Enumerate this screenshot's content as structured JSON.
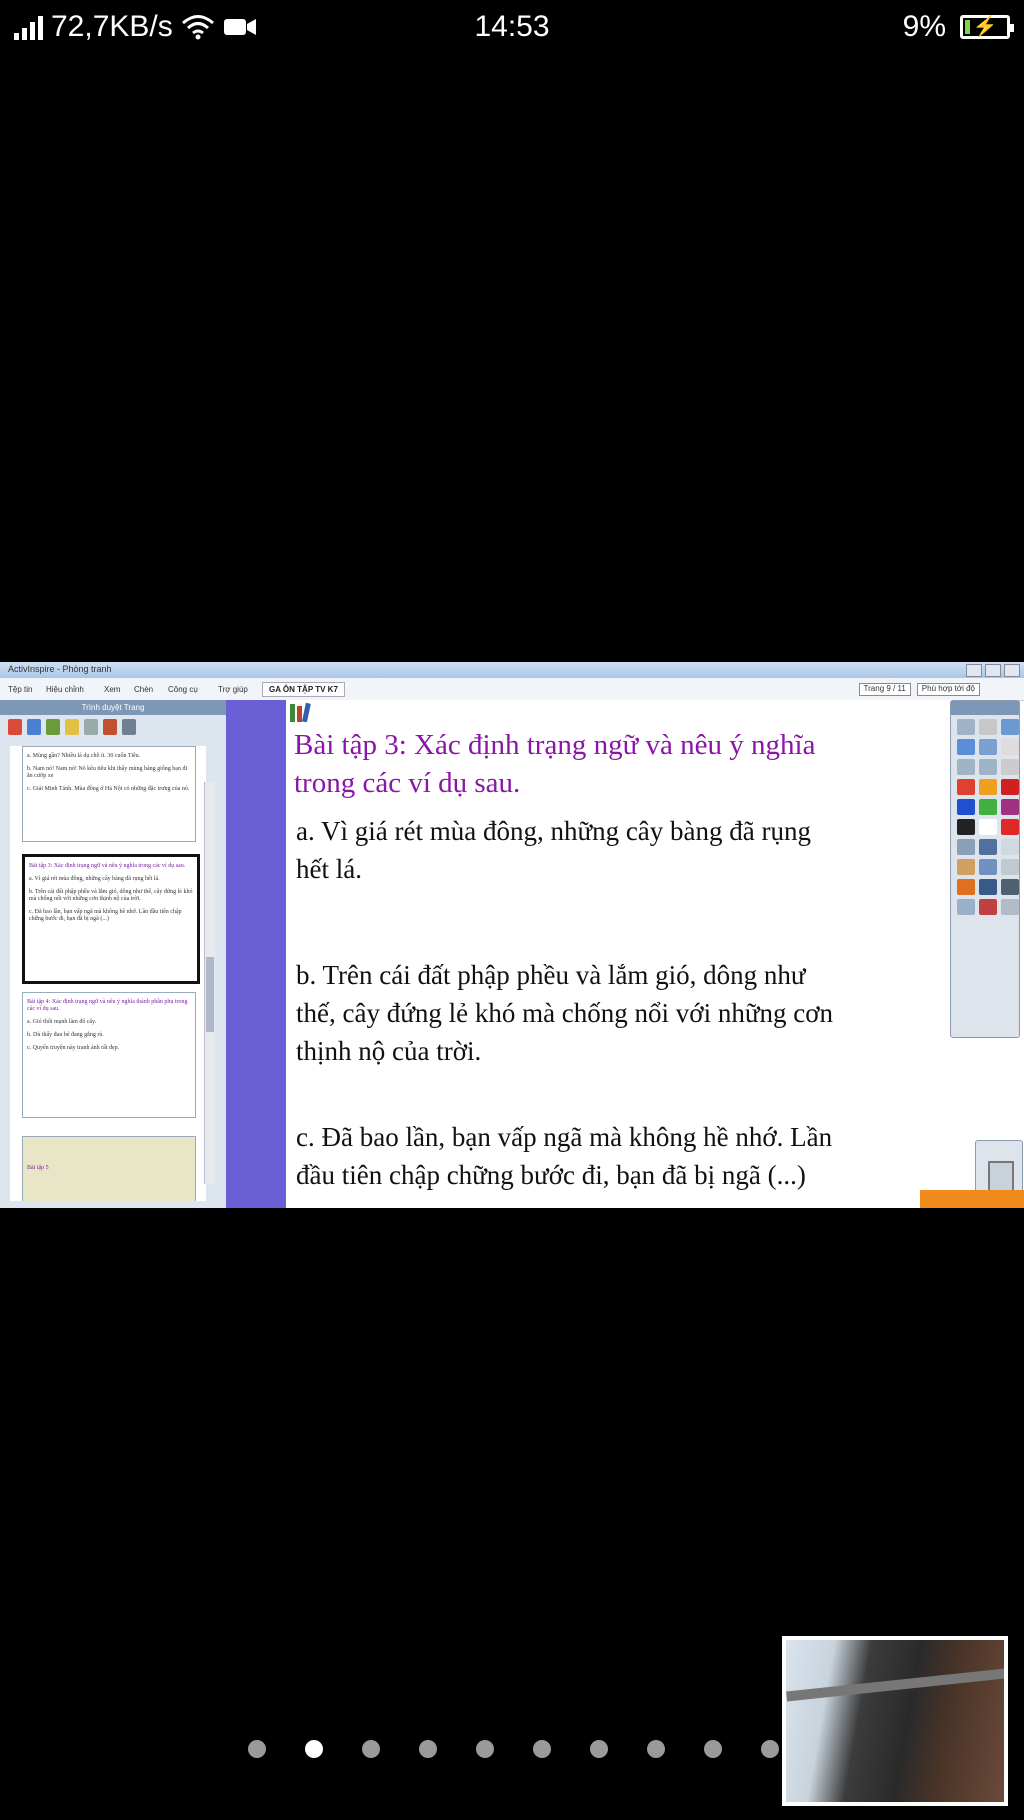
{
  "status_bar": {
    "network_speed": "72,7KB/s",
    "time": "14:53",
    "battery": "9%",
    "icons": [
      "signal-icon",
      "wifi-icon",
      "video-camera-icon",
      "battery-charging-icon"
    ]
  },
  "app": {
    "window_title": "ActivInspire - Phòng tranh",
    "menus": [
      "Tệp tin",
      "Hiệu chỉnh",
      "Xem",
      "Chèn",
      "Công cụ",
      "Trợ giúp"
    ],
    "document_tab": "GA ÔN TẬP TV K7",
    "page_indicator": "Trang 9 / 11",
    "zoom_select": "Phù hợp tới độ"
  },
  "page_browser": {
    "title": "Trình duyệt Trang",
    "thumbnails": [
      {
        "lines": [
          "a. Mùng gần? Nhiều lá dụ chỗ ít. 30 cuốn Tiêu.",
          "b. Nam nó! Nam nó! Nó kêu tiêu khi thấy mùng hàng giống bạn đi ăn cướp xe",
          "c. Giải Minh Tánh. Mùa đông ở Hà Nội có những đặc trưng của nó."
        ]
      },
      {
        "title": "Bài tập 3: Xác định trạng ngữ và nêu ý nghĩa trong các ví dụ sau.",
        "lines": [
          "a. Vì giá rét mùa đông, những cây bàng đã rụng hết lá.",
          "b. Trên cái đất phập phều và lắm gió, dông như thế, cây đứng lẻ khó mà chống nổi với những cơn thịnh nộ của trời.",
          "c. Đã bao lần, bạn vấp ngã mà không hề nhớ. Lần đầu tiên chập chững bước đi, bạn đã bị ngã (...)"
        ]
      },
      {
        "title": "Bài tập 4: Xác định trạng ngữ và nêu ý nghĩa thành phần phụ trong các ví dụ sau.",
        "lines": [
          "a. Gió thổi mạnh làm đổ cây.",
          "b. Dù thấy đau bé đang gắng rủ.",
          "c. Quyển truyện này tranh ảnh rất đẹp."
        ]
      },
      {
        "title": "Bài tập 5",
        "lines": []
      }
    ]
  },
  "slide": {
    "title": "Bài tập 3: Xác định trạng ngữ và nêu ý nghĩa trong các ví dụ sau.",
    "items": [
      "a. Vì giá rét mùa đông, những cây bàng đã rụng hết lá.",
      "b. Trên cái đất phập phều và lắm gió, dông như thế, cây đứng lẻ khó mà chống nổi với những cơn thịnh nộ của trời.",
      "c. Đã bao lần, bạn vấp ngã mà không hề nhớ. Lần đầu tiên chập chững bước đi, bạn đã bị ngã (...)"
    ]
  },
  "pager": {
    "count": 10,
    "active_index": 1
  }
}
